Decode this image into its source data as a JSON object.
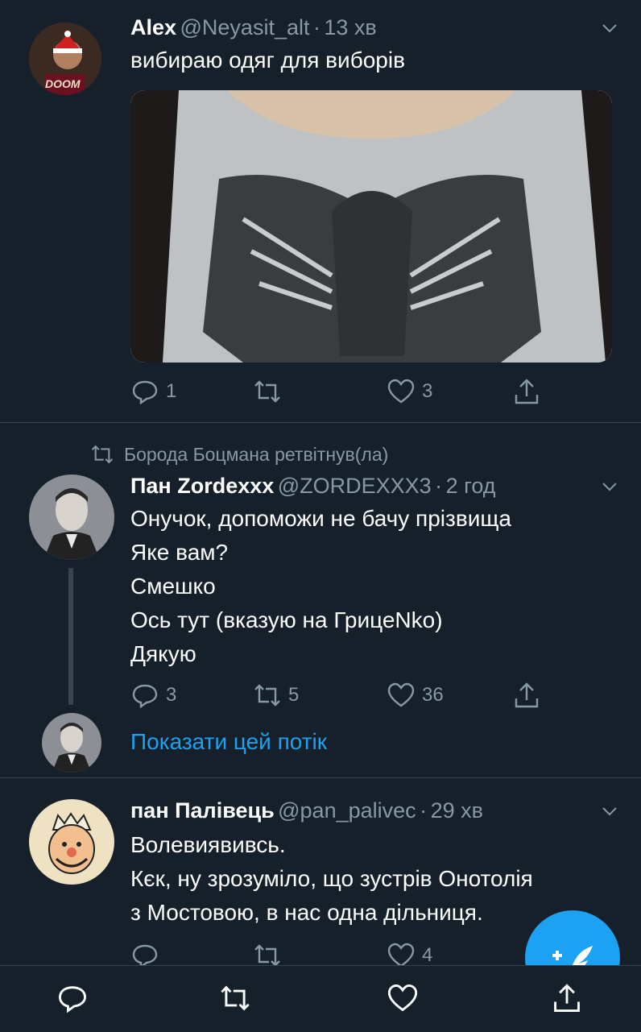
{
  "tweet1": {
    "name": "Alex",
    "handle": "@Neyasit_alt",
    "time": "13 хв",
    "text": "вибираю одяг для виборів",
    "avatar_text": "DOOM",
    "replies": "1",
    "retweets": "",
    "likes": "3"
  },
  "tweet2": {
    "retweet_context": "Борода Боцмана ретвітнув(ла)",
    "name": "Пан Zordexxx",
    "handle": "@ZORDEXXX3",
    "time": "2 год",
    "lines": [
      "Онучок, допоможи не бачу прізвища",
      "Яке вам?",
      "Смешко",
      "Ось тут (вказую на ГрицеNko)",
      "Дякую"
    ],
    "replies": "3",
    "retweets": "5",
    "likes": "36",
    "show_thread": "Показати цей потік"
  },
  "tweet3": {
    "name": "пан Палівець",
    "handle": "@pan_palivec",
    "time": "29 хв",
    "lines": [
      "Волевиявивсь.",
      "Кєк, ну зрозуміло, що зустрів Онотолія",
      "з Мостовою, в нас одна дільниця."
    ],
    "replies": "",
    "retweets": "",
    "likes": "4"
  },
  "colors": {
    "background": "#15202b",
    "accent": "#1da1f2",
    "muted": "#8899a6",
    "divider": "#38444d"
  },
  "icons": [
    "reply-icon",
    "retweet-icon",
    "like-icon",
    "share-icon",
    "chevron-down-icon",
    "compose-icon"
  ]
}
